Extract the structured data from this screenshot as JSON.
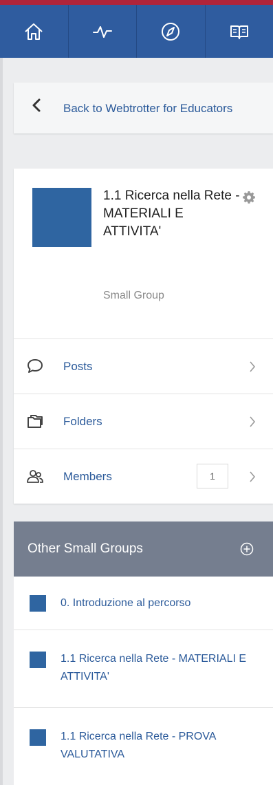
{
  "nav": {
    "items": [
      {
        "icon": "home-icon"
      },
      {
        "icon": "activity-icon"
      },
      {
        "icon": "compass-icon"
      },
      {
        "icon": "book-icon"
      }
    ]
  },
  "back": {
    "label": "Back to Webtrotter for Educators"
  },
  "group": {
    "title": "1.1 Ricerca nella Rete - MATERIALI E ATTIVITA'",
    "type": "Small Group",
    "thumb_color": "#2f65a1",
    "menu": {
      "posts": "Posts",
      "folders": "Folders",
      "members": "Members",
      "members_count": "1"
    }
  },
  "other_groups": {
    "title": "Other Small Groups",
    "items": [
      "0. Introduzione al percorso",
      "1.1 Ricerca nella Rete - MATERIALI E ATTIVITA'",
      "1.1 Ricerca nella Rete - PROVA VALUTATIVA"
    ]
  },
  "colors": {
    "nav_bg": "#2f5c9f",
    "top_stripe": "#b0243a",
    "link": "#2b5a9a",
    "header_gray": "#757e8f"
  }
}
